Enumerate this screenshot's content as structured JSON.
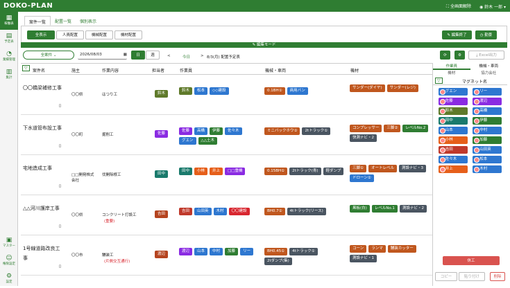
{
  "app": {
    "logo": "DOKO-PLAN",
    "fullscreen": "全画面解除",
    "user": "鈴木 一郎"
  },
  "sidebar": [
    {
      "label": "稼働表",
      "active": true
    },
    {
      "label": "予定表"
    },
    {
      "label": "業績管理"
    },
    {
      "label": "集計"
    },
    {
      "label": "マスター"
    },
    {
      "label": "権限設定"
    },
    {
      "label": "設定"
    }
  ],
  "tabs": [
    "案件一覧",
    "配置一覧",
    "個別表示"
  ],
  "subtabs": [
    "全表示",
    "人員配置",
    "機械配置",
    "機材配置"
  ],
  "buttons": {
    "edit_end": "編集終了",
    "attend": "勤景",
    "excel": "Excel出力",
    "prev": "<",
    "next": ">",
    "today": "今日"
  },
  "edit_mode": "編集モード",
  "controls": {
    "filter": "全案件",
    "date": "2026/08/03",
    "day": "日",
    "week": "週",
    "title": "8/3(月) 配置予定表"
  },
  "headers": [
    "案件名",
    "施主",
    "作業内容",
    "担当者",
    "作業員",
    "機械・車両",
    "機材"
  ],
  "rows": [
    {
      "name": "〇〇橋梁補修工事",
      "owner": "〇〇県",
      "work": "はつり工",
      "staff": "鈴木",
      "workers": [
        "鈴木",
        "松本",
        "◇◇建設"
      ],
      "machines": [
        "0.1BH①",
        "商用バン"
      ],
      "equip": [
        "サンダー(ダイヤ)",
        "サンダー(レジ)"
      ]
    },
    {
      "name": "下水道管布設工事",
      "owner": "〇〇町",
      "work": "掘削工",
      "staff": "佐藤",
      "workers": [
        "佐藤",
        "高橋",
        "伊藤",
        "佐々木",
        "グエン",
        "△△土木"
      ],
      "machines": [
        "ミニバックホウ①",
        "2tトラック①"
      ],
      "equip": [
        "コンプレッサー",
        "三脚②",
        "レベルNo.2",
        "快測ナビ・2"
      ]
    },
    {
      "name": "宅地造成工事",
      "owner": "□□開発株式会社",
      "work": "伐開除根工",
      "staff": "田中",
      "workers": [
        "田中",
        "小林",
        "井上",
        "□□重機"
      ],
      "machines": [
        "0.15BH①",
        "2tトラック(青)",
        "軽ダンプ"
      ],
      "equip": [
        "三脚①",
        "オートレベル",
        "測設ナビ・3",
        "ドローン①"
      ]
    },
    {
      "name": "△△河川護岸工事",
      "owner": "〇〇県",
      "work": "コンクリート打設工",
      "note": "(重要)",
      "staff": "吉田",
      "workers": [
        "吉田",
        "山田英",
        "木村",
        "〇〇建設"
      ],
      "machines": [
        "BH0.7①",
        "4tトラック(リース)"
      ],
      "equip": [
        "黒板(白)",
        "レベルNo.1",
        "測設ナビ・2"
      ]
    },
    {
      "name": "1号線道路改良工事",
      "owner": "〇〇市",
      "work": "舗装工",
      "note": "(片側交互通行)",
      "staff": "渡辺",
      "workers": [
        "渡辺",
        "山本",
        "中村",
        "加藤",
        "リー"
      ],
      "machines": [
        "BH0.45①",
        "4tトラック①",
        "2tダンプ(集)"
      ],
      "equip": [
        "コーン",
        "ランマ",
        "舗装カッター",
        "測設ナビ・1"
      ]
    }
  ],
  "panel": {
    "tabs": [
      "作業員",
      "機械・車両"
    ],
    "sub": [
      "機材",
      "協力会社"
    ],
    "col": "マグネット名",
    "magnets": [
      "グエン",
      "リー",
      "佐藤",
      "渡辺",
      "鈴木",
      "高橋",
      "田中",
      "伊藤",
      "山本",
      "中村",
      "小林",
      "加藤",
      "吉田",
      "山田英",
      "佐々木",
      "松本",
      "井上",
      "木村"
    ],
    "rest": "休工",
    "copy": "コピー",
    "paste": "貼り付け",
    "delete": "削除"
  }
}
